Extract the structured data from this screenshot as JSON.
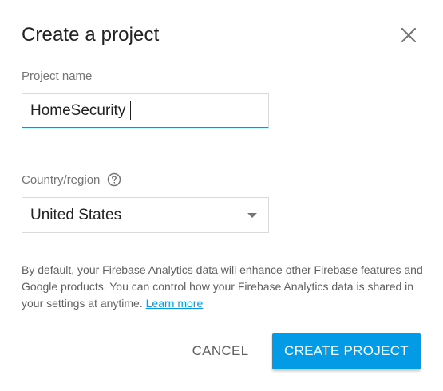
{
  "dialog": {
    "title": "Create a project",
    "close_icon": "close-icon"
  },
  "project_name": {
    "label": "Project name",
    "value": "HomeSecurity"
  },
  "country_region": {
    "label": "Country/region",
    "help_icon": "help-circle-icon",
    "selected": "United States",
    "dropdown_icon": "arrow-drop-down-icon"
  },
  "description": {
    "text": "By default, your Firebase Analytics data will enhance other Firebase features and Google products. You can control how your Firebase Analytics data is shared in your settings at anytime. ",
    "link_text": "Learn more"
  },
  "actions": {
    "cancel_label": "CANCEL",
    "create_label": "CREATE PROJECT"
  },
  "colors": {
    "accent": "#039be5",
    "focus_underline": "#1e88e5",
    "title_text": "#212121",
    "label_text": "#757575"
  }
}
